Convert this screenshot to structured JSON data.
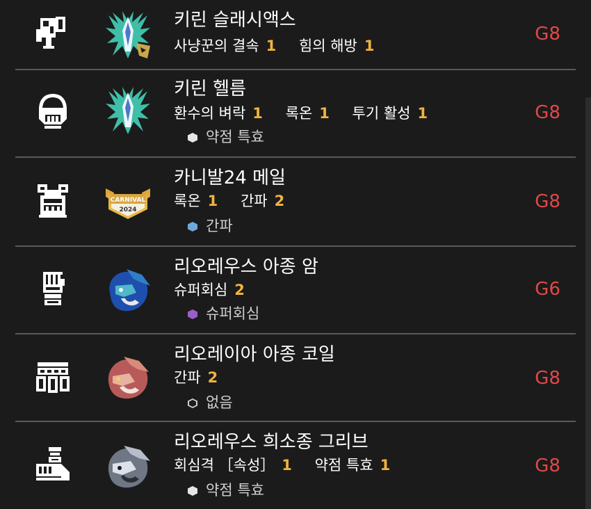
{
  "colors": {
    "background": "#1b1b1b",
    "skill_level": "#f2b33d",
    "rank": "#e14848",
    "divider": "#5a5a5a"
  },
  "equipment": [
    {
      "slot_icon": "weapon-charge-blade-icon",
      "monster_icon": "kirin-icon",
      "name": "키린 슬래시액스",
      "skills": [
        {
          "name": "사냥꾼의 결속",
          "level": "1"
        },
        {
          "name": "힘의 해방",
          "level": "1"
        }
      ],
      "rank": "G8"
    },
    {
      "slot_icon": "helm-icon",
      "monster_icon": "kirin-icon",
      "name": "키린 헬름",
      "skills": [
        {
          "name": "환수의 벼락",
          "level": "1"
        },
        {
          "name": "록온",
          "level": "1"
        },
        {
          "name": "투기 활성",
          "level": "1"
        }
      ],
      "decoration": {
        "name": "약점 특효",
        "color": "#e6e6e6"
      },
      "rank": "G8"
    },
    {
      "slot_icon": "chest-armor-icon",
      "monster_icon": "carnival-2024-badge-icon",
      "badge_text": "CARNIVAL",
      "badge_year": "2024",
      "name": "카니발24 메일",
      "skills": [
        {
          "name": "록온",
          "level": "1"
        },
        {
          "name": "간파",
          "level": "2"
        }
      ],
      "decoration": {
        "name": "간파",
        "color": "#6fa8d8"
      },
      "rank": "G8"
    },
    {
      "slot_icon": "arm-gauntlet-icon",
      "monster_icon": "azure-rathalos-icon",
      "name": "리오레우스 아종 암",
      "skills": [
        {
          "name": "슈퍼회심",
          "level": "2"
        }
      ],
      "decoration": {
        "name": "슈퍼회심",
        "color": "#9a5fc6"
      },
      "rank": "G6"
    },
    {
      "slot_icon": "waist-coil-icon",
      "monster_icon": "pink-rathian-icon",
      "name": "리오레이아 아종 코일",
      "skills": [
        {
          "name": "간파",
          "level": "2"
        }
      ],
      "decoration": {
        "name": "없음",
        "color": "empty"
      },
      "rank": "G8"
    },
    {
      "slot_icon": "legs-greaves-icon",
      "monster_icon": "silver-rathalos-icon",
      "name": "리오레우스 희소종 그리브",
      "skills": [
        {
          "name": "회심격 ［속성］",
          "level": "1"
        },
        {
          "name": "약점 특효",
          "level": "1"
        }
      ],
      "decoration": {
        "name": "약점 특효",
        "color": "#e6e6e6"
      },
      "rank": "G8"
    }
  ]
}
